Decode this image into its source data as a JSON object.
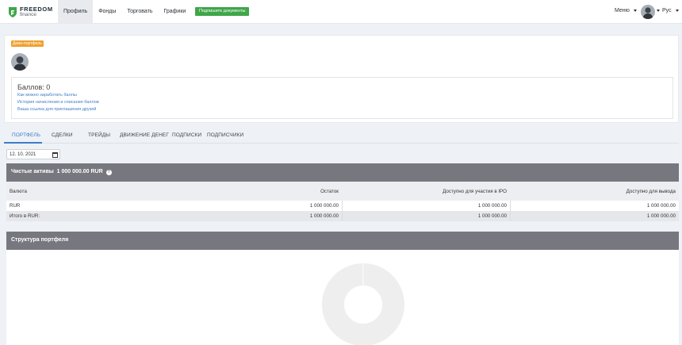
{
  "header": {
    "logo": {
      "line1": "FREEDOM",
      "line2": "finance"
    },
    "nav": [
      {
        "label": "Профиль",
        "active": true
      },
      {
        "label": "Фонды",
        "active": false
      },
      {
        "label": "Торговать",
        "active": false
      },
      {
        "label": "Графики",
        "active": false
      }
    ],
    "sign_button": "Подпишите документы",
    "menu_label": "Меню",
    "lang_label": "Рус"
  },
  "profile": {
    "badge": "Демо-портфель",
    "points_title": "Баллов: 0",
    "links": [
      "Как можно заработать баллы",
      "История начисления и списания баллов",
      "Ваша ссылка для приглашения друзей"
    ]
  },
  "tabs": [
    "ПОРТФЕЛЬ",
    "СДЕЛКИ",
    "ТРЕЙДЫ",
    "ДВИЖЕНИЕ ДЕНЕГ",
    "ПОДПИСКИ",
    "ПОДПИСЧИКИ"
  ],
  "date_value": "12. 10. 2021",
  "net_assets": {
    "label": "Чистые активы",
    "value": "1 000 000.00 RUR"
  },
  "table": {
    "columns": [
      "Валюта",
      "Остаток",
      "Доступно для участия в IPO",
      "Доступно для вывода"
    ],
    "rows": [
      [
        "RUR",
        "1 000 000.00",
        "1 000 000.00",
        "1 000 000.00"
      ],
      [
        "Итого в RUR:",
        "1 000 000.00",
        "1 000 000.00",
        "1 000 000.00"
      ]
    ]
  },
  "structure_title": "Структура портфеля",
  "colors": {
    "brand_green": "#3fa64a",
    "badge_orange": "#f0a030",
    "link_blue": "#3f7cc9",
    "panel_gray": "#77787f"
  }
}
